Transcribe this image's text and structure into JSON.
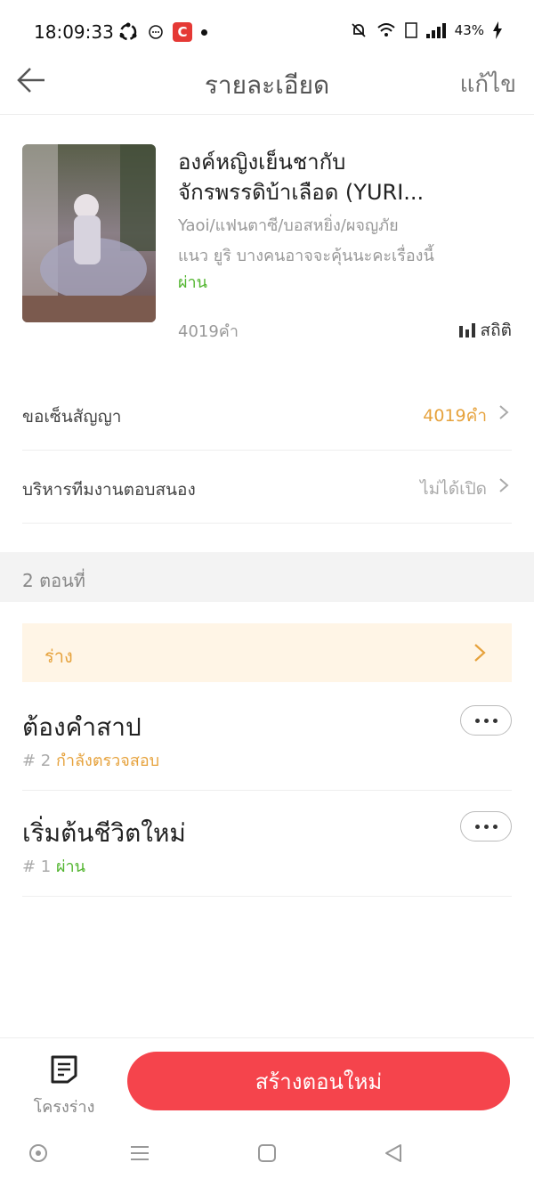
{
  "status_bar": {
    "time": "18:09:33",
    "battery": "43%"
  },
  "header": {
    "title": "รายละเอียด",
    "edit_label": "แก้ไข"
  },
  "book": {
    "title_line1": "องค์หญิงเย็นชากับ",
    "title_line2": "จักรพรรดิบ้าเลือด (YURI...",
    "genre": "Yaoi/แฟนตาซี/บอสหยิ่ง/ผจญภัย",
    "description": "แนว ยูริ บางคนอาจจะคุ้นนะคะเรื่องนี้",
    "status": "ผ่าน",
    "word_count": "4019คำ",
    "stats_label": "สถิติ"
  },
  "rows": [
    {
      "label": "ขอเซ็นสัญญา",
      "value": "4019คำ",
      "value_color": "#e6a23c"
    },
    {
      "label": "บริหารทีมงานตอบสนอง",
      "value": "ไม่ได้เปิด",
      "value_color": "#aaaaaa"
    }
  ],
  "episodes_header": "2 ตอนที่",
  "draft_label": "ร่าง",
  "episodes": [
    {
      "title": "ต้องคำสาป",
      "number": "# 2",
      "status": "กำลังตรวจสอบ",
      "status_color": "#e6a23c"
    },
    {
      "title": "เริ่มต้นชีวิตใหม่",
      "number": "# 1",
      "status": "ผ่าน",
      "status_color": "#52b52f"
    }
  ],
  "bottom": {
    "outline_label": "โครงร่าง",
    "create_label": "สร้างตอนใหม่"
  },
  "colors": {
    "accent_red": "#f5444c",
    "pending_orange": "#e6a23c",
    "pass_green": "#52b52f"
  }
}
